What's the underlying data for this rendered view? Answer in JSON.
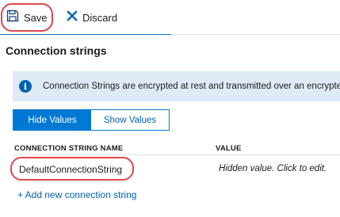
{
  "toolbar": {
    "save_label": "Save",
    "discard_label": "Discard",
    "icons": {
      "save": "floppy-disk-icon",
      "discard": "x-icon"
    }
  },
  "section": {
    "title": "Connection strings"
  },
  "info": {
    "icon": "info-icon",
    "text": "Connection Strings are encrypted at rest and transmitted over an encrypted channel."
  },
  "toggle": {
    "hide_label": "Hide Values",
    "show_label": "Show Values",
    "selected": "Hide Values"
  },
  "table": {
    "columns": [
      "CONNECTION STRING NAME",
      "VALUE"
    ],
    "rows": [
      {
        "name": "DefaultConnectionString",
        "value": "Hidden value. Click to edit."
      }
    ]
  },
  "add_link": "+ Add new connection string",
  "colors": {
    "accent": "#0078d4",
    "info_bg": "#dfeaf7",
    "highlight": "#e0474c"
  }
}
